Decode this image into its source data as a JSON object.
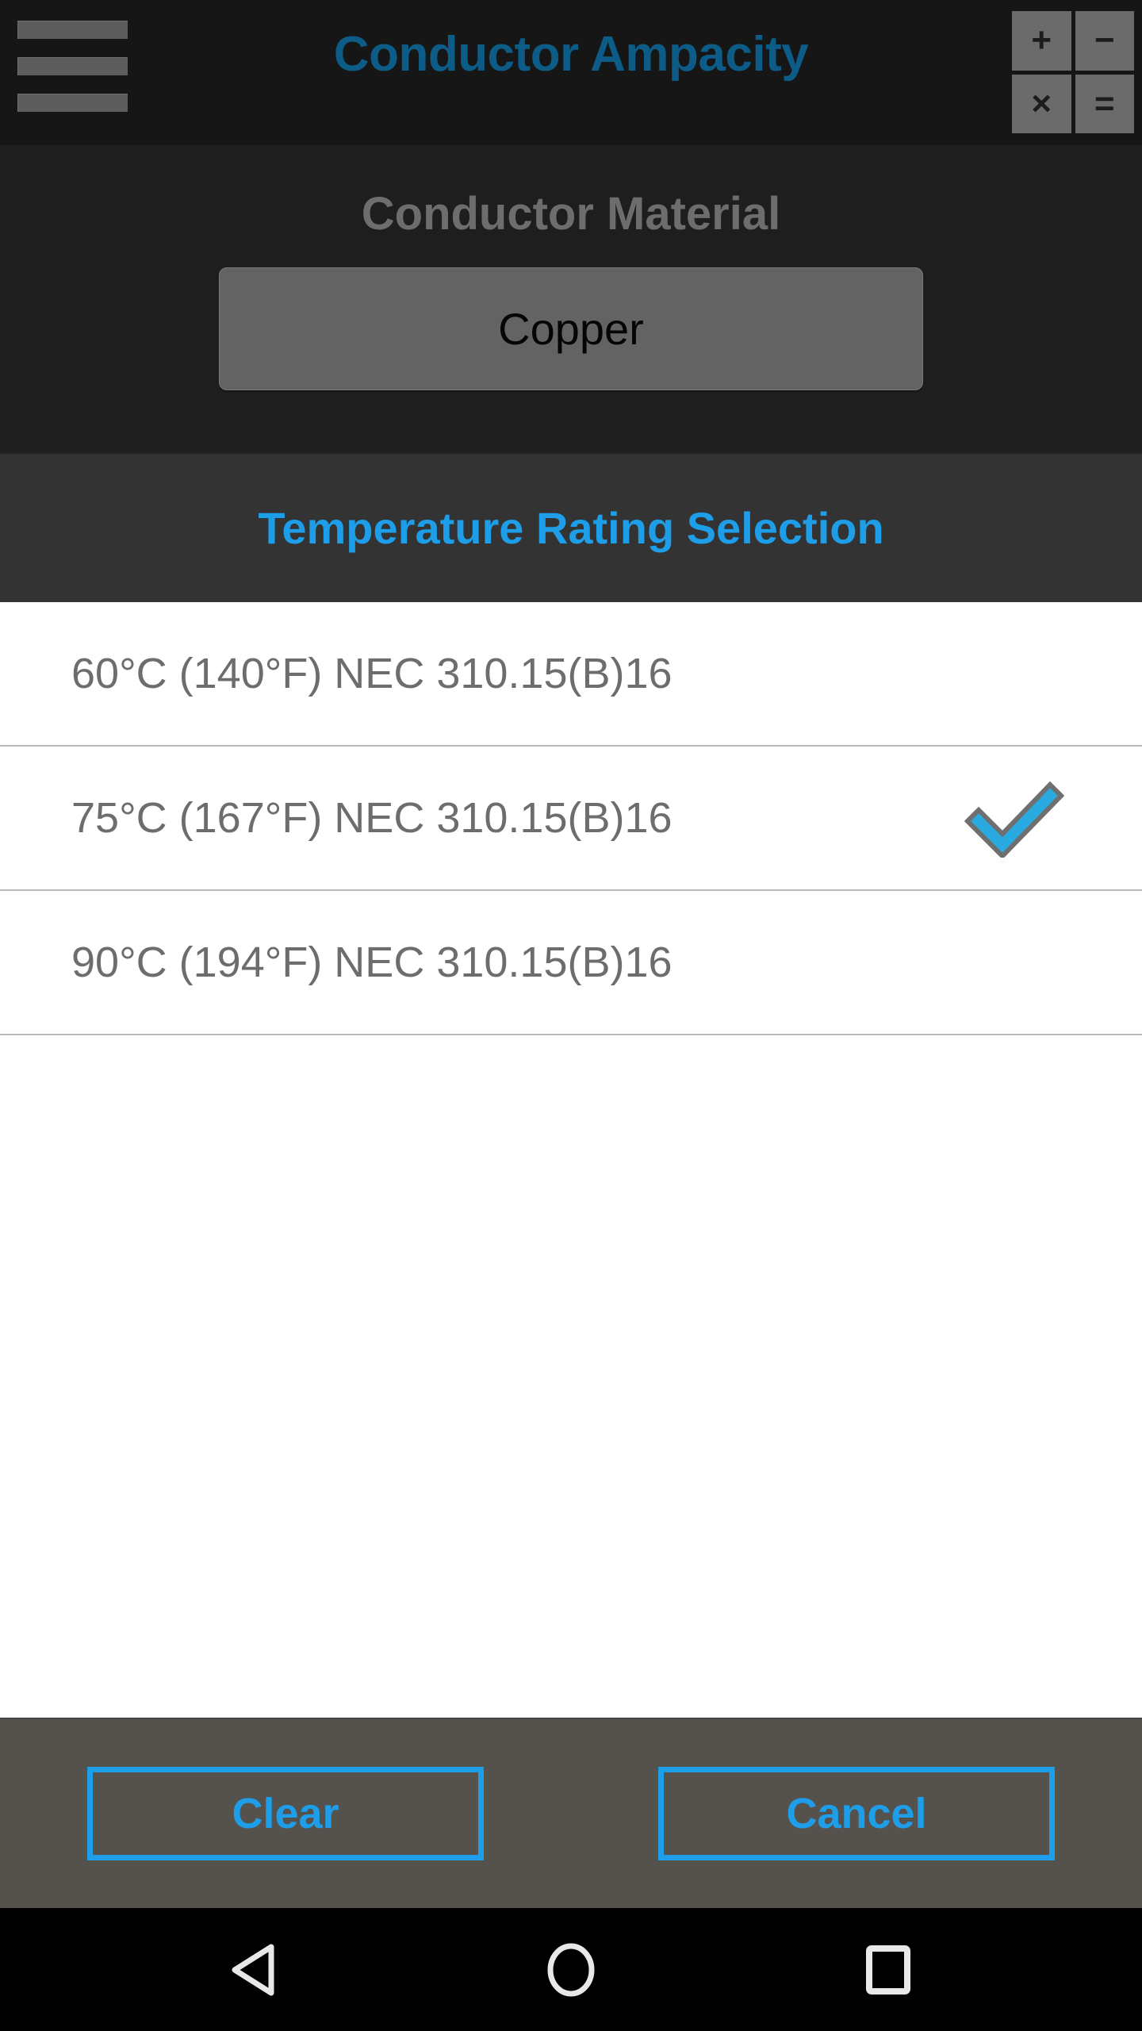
{
  "app": {
    "title": "Conductor Ampacity",
    "title_color": "#0c5c87",
    "accent_color": "#1e9ee8",
    "appbar_bg": "#161616"
  },
  "appbar": {
    "menu_icon": "hamburger-menu-icon",
    "calculator_icon": "calculator-icon",
    "calculator_keys": [
      "+",
      "−",
      "×",
      "="
    ]
  },
  "material": {
    "label": "Conductor Material",
    "selected": "Copper"
  },
  "section": {
    "title": "Temperature Rating Selection"
  },
  "list": {
    "items": [
      {
        "label": "60°C (140°F) NEC 310.15(B)16",
        "selected": false
      },
      {
        "label": "75°C (167°F) NEC 310.15(B)16",
        "selected": true
      },
      {
        "label": "90°C (194°F) NEC 310.15(B)16",
        "selected": false
      }
    ],
    "check_icon": "check-icon",
    "check_color": "#29ABE2"
  },
  "footer": {
    "clear_label": "Clear",
    "cancel_label": "Cancel",
    "bg": "#55524d"
  },
  "navbar": {
    "back_icon": "back-triangle-icon",
    "home_icon": "home-circle-icon",
    "recents_icon": "recents-square-icon"
  }
}
